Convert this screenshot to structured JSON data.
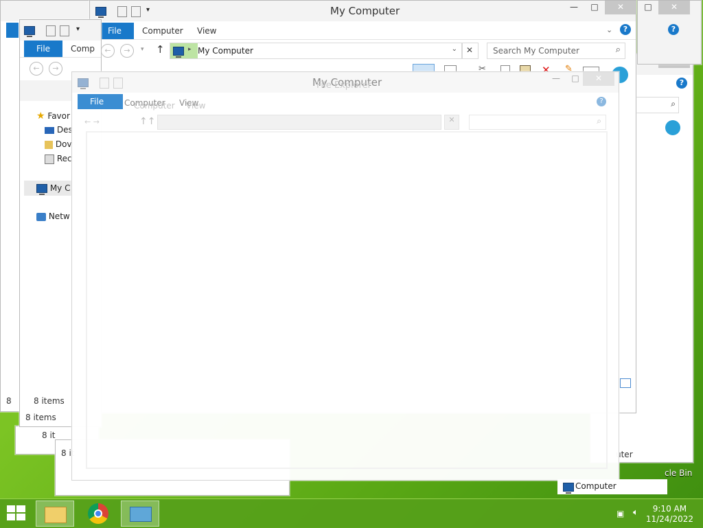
{
  "colors": {
    "accent": "#1979ca",
    "taskbar": "#56a01a",
    "desktop": "#7cc424"
  },
  "main_window": {
    "title": "My Computer",
    "tabs": [
      "File",
      "Computer",
      "View"
    ],
    "address": "My Computer",
    "search_placeholder": "Search My Computer",
    "status_items": "Computer"
  },
  "left_window": {
    "tabs": [
      "File",
      "Comp"
    ],
    "nav": {
      "favorites": "Favor",
      "desktop": "Des",
      "downloads": "Dov",
      "recent": "Rec",
      "computer": "My C",
      "network": "Netw"
    },
    "status": "8 items"
  },
  "back_windows": {
    "status_a": "8 items",
    "status_b": "8 it",
    "status_c": "8 it",
    "status_d": "8 it",
    "status_e": "8",
    "right_status": "uter"
  },
  "front_window": {
    "title_a": "My Computer",
    "title_b": "File Explorer",
    "tabs": [
      "File",
      "Computer",
      "View"
    ],
    "tabs_ghost": [
      "File",
      "Computer",
      "View"
    ]
  },
  "desktop_labels": {
    "recycle_bin": "cle Bin"
  },
  "taskbar": {
    "time": "9:10 AM",
    "date": "11/24/2022",
    "apps": [
      "start",
      "file-explorer",
      "chrome",
      "remote-desktop"
    ]
  }
}
